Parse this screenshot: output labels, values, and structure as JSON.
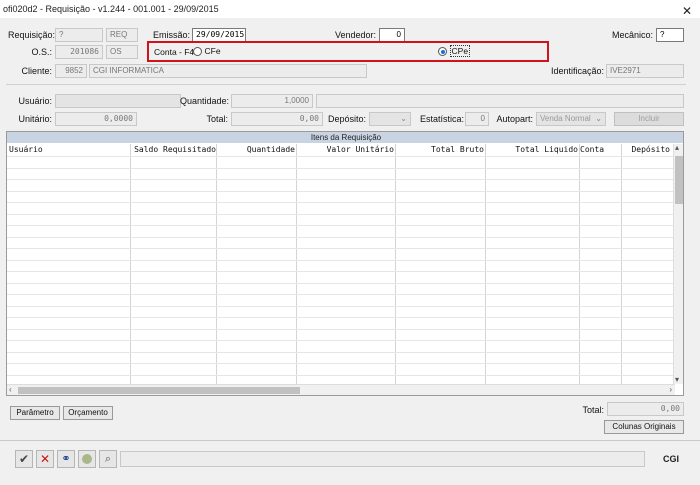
{
  "window": {
    "title": "ofi020d2 - Requisição - v1.244 - 001.001 - 29/09/2015",
    "close": "✕"
  },
  "header": {
    "requisicao_label": "Requisição:",
    "requisicao_value": "?",
    "requisicao_code": "REQ",
    "emissao_label": "Emissão:",
    "emissao_value": "29/09/2015",
    "vendedor_label": "Vendedor:",
    "vendedor_value": "0",
    "mecanico_label": "Mecânico:",
    "mecanico_value": "?",
    "os_label": "O.S.:",
    "os_value": "201086",
    "os_code": "OS",
    "conta_label": "Conta - F4:",
    "conta_option1": "CFe",
    "conta_option2": "CPe",
    "conta_selected": "CPe",
    "cliente_label": "Cliente:",
    "cliente_code": "9852",
    "cliente_name": "CGI INFORMATICA",
    "identificacao_label": "Identificação:",
    "identificacao_value": "IVE2971"
  },
  "item_form": {
    "usuario_label": "Usuário:",
    "usuario_value": "",
    "quantidade_label": "Quantidade:",
    "quantidade_value": "1,0000",
    "unitario_label": "Unitário:",
    "unitario_value": "0,0000",
    "total_label": "Total:",
    "total_value": "0,00",
    "deposito_label": "Depósito:",
    "deposito_value": "",
    "estatistica_label": "Estatística:",
    "estatistica_value": "0",
    "autopart_label": "Autopart:",
    "autopart_value": "Venda Normal",
    "incluir_label": "Incluir"
  },
  "grid": {
    "title": "Itens da Requisição",
    "columns": [
      "Usuário",
      "Saldo Requisitado",
      "Quantidade",
      "Valor Unitário",
      "Total Bruto",
      "Total Liquido",
      "Conta",
      "Depósito"
    ]
  },
  "footer": {
    "parametro_label": "Parâmetro",
    "orcamento_label": "Orçamento",
    "total_label": "Total:",
    "total_value": "0,00",
    "colunas_label": "Colunas Originais"
  },
  "toolbar": {
    "logo_text": "CGI"
  }
}
